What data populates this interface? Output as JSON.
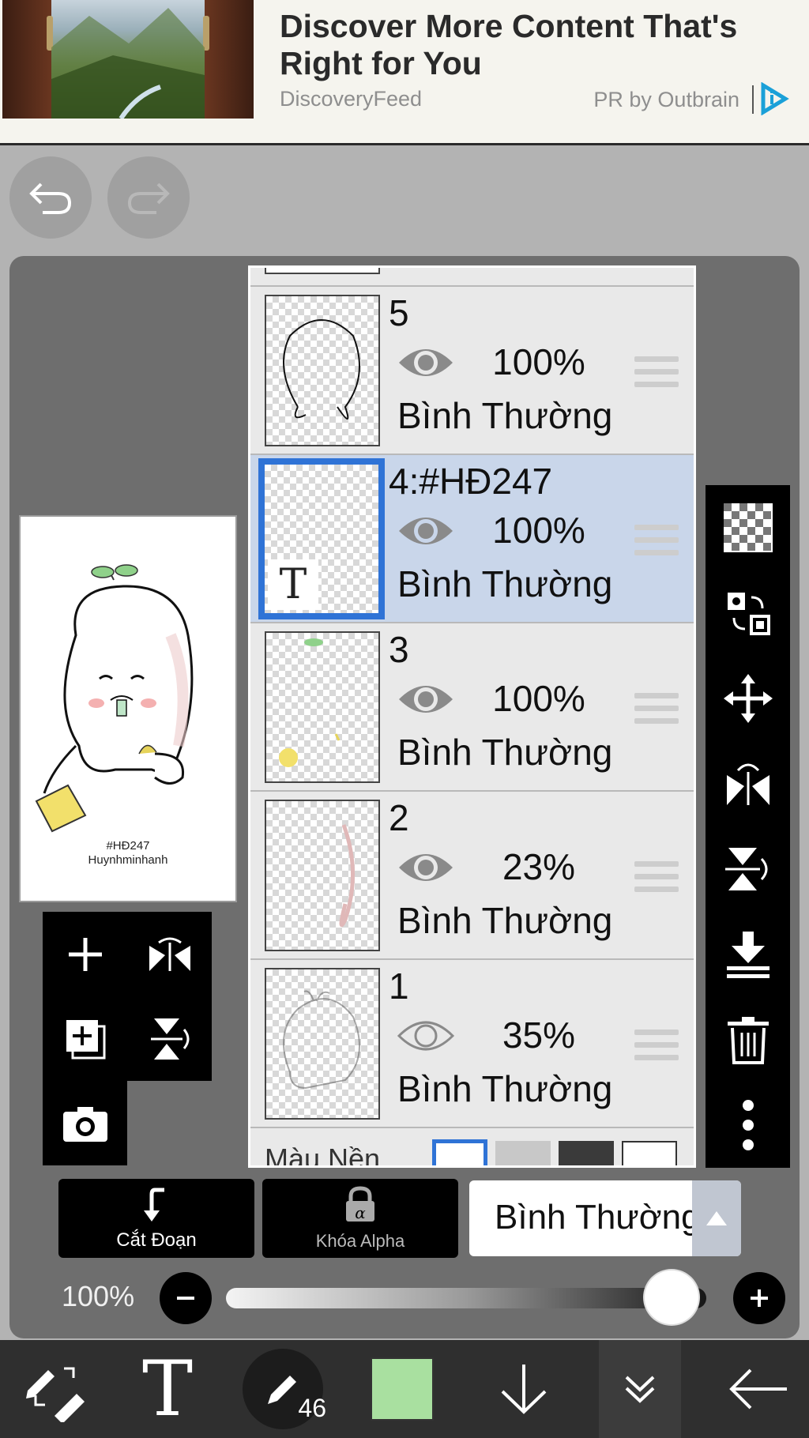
{
  "ad": {
    "title": "Discover More Content That's Right for You",
    "source": "DiscoveryFeed",
    "pr": "PR by Outbrain"
  },
  "preview": {
    "line1": "#HĐ247",
    "line2": "Huynhminhanh"
  },
  "layers": [
    {
      "name": "5",
      "opacity": "100%",
      "blend": "Bình Thường",
      "visible": true,
      "selected": false
    },
    {
      "name": "4:#HĐ247",
      "opacity": "100%",
      "blend": "Bình Thường",
      "visible": true,
      "selected": true
    },
    {
      "name": "3",
      "opacity": "100%",
      "blend": "Bình Thường",
      "visible": true,
      "selected": false
    },
    {
      "name": "2",
      "opacity": "23%",
      "blend": "Bình Thường",
      "visible": true,
      "selected": false
    },
    {
      "name": "1",
      "opacity": "35%",
      "blend": "Bình Thường",
      "visible": false,
      "selected": false
    }
  ],
  "layer_list_footer": "Màu Nền",
  "controls": {
    "clipping_label": "Cắt Đoạn",
    "alpha_lock_label": "Khóa Alpha",
    "blend_mode": "Bình Thường",
    "opacity_label": "100%",
    "opacity_value": 100
  },
  "toolbar": {
    "brush_size": "46",
    "color": "#a9e0a0"
  },
  "icons": {
    "undo": "undo-icon",
    "redo": "redo-icon",
    "add_layer": "plus-icon",
    "flip_h": "flip-horizontal-icon",
    "add_copy": "add-copy-icon",
    "flip_v": "flip-vertical-icon",
    "camera": "camera-icon",
    "transparent": "checkerboard-icon",
    "move_select": "move-selection-icon",
    "move": "move-icon",
    "merge": "merge-down-icon",
    "delete": "trash-icon",
    "more": "more-vertical-icon"
  }
}
